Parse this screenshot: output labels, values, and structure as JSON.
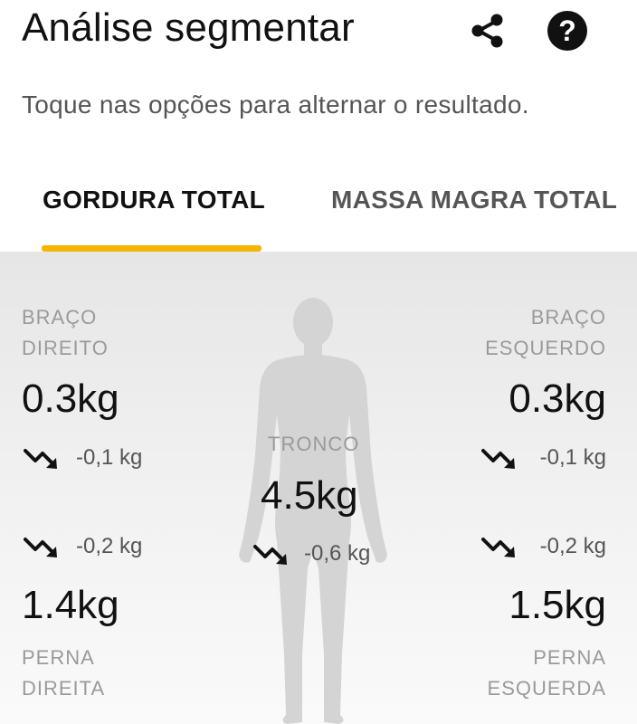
{
  "header": {
    "title": "Análise segmentar",
    "share_icon": "share-icon",
    "help_icon": "help-icon",
    "help_glyph": "?"
  },
  "subtitle": "Toque nas opções para alternar o resultado.",
  "tabs": [
    {
      "label": "GORDURA TOTAL",
      "active": true
    },
    {
      "label": "MASSA MAGRA TOTAL",
      "active": false
    }
  ],
  "colors": {
    "accent": "#f5b400",
    "figure": "#d4d4d4"
  },
  "segments": {
    "right_arm": {
      "label_line1": "BRAÇO",
      "label_line2": "DIREITO",
      "value": "0.3kg",
      "delta": "-0,1 kg",
      "trend_icon": "trend-down-icon"
    },
    "left_arm": {
      "label_line1": "BRAÇO",
      "label_line2": "ESQUERDO",
      "value": "0.3kg",
      "delta": "-0,1 kg",
      "trend_icon": "trend-down-icon"
    },
    "trunk": {
      "label": "TRONCO",
      "value": "4.5kg",
      "delta": "-0,6 kg",
      "trend_icon": "trend-down-icon"
    },
    "right_leg": {
      "label_line1": "PERNA",
      "label_line2": "DIREITA",
      "value": "1.4kg",
      "delta": "-0,2 kg",
      "trend_icon": "trend-down-icon"
    },
    "left_leg": {
      "label_line1": "PERNA",
      "label_line2": "ESQUERDA",
      "value": "1.5kg",
      "delta": "-0,2 kg",
      "trend_icon": "trend-down-icon"
    }
  }
}
